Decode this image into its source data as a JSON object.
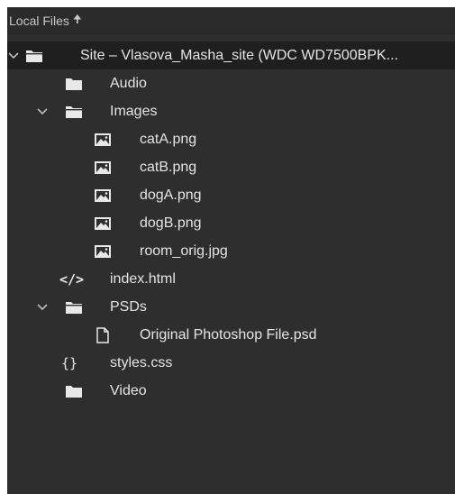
{
  "header": {
    "title": "Local Files",
    "sort_icon": "arrow-up-icon"
  },
  "tree": {
    "site": {
      "label": "Site – Vlasova_Masha_site (WDC WD7500BPK...",
      "expanded": true
    },
    "audio": {
      "label": "Audio"
    },
    "images": {
      "label": "Images",
      "expanded": true
    },
    "catA": {
      "label": "catA.png"
    },
    "catB": {
      "label": "catB.png"
    },
    "dogA": {
      "label": "dogA.png"
    },
    "dogB": {
      "label": "dogB.png"
    },
    "room": {
      "label": "room_orig.jpg"
    },
    "index": {
      "label": "index.html"
    },
    "psds": {
      "label": "PSDs",
      "expanded": true
    },
    "psdfile": {
      "label": "Original Photoshop File.psd"
    },
    "styles": {
      "label": "styles.css"
    },
    "video": {
      "label": "Video"
    }
  },
  "icons": {
    "folder": "folder-icon",
    "image": "image-file-icon",
    "code": "code-file-icon",
    "document": "document-icon",
    "css": "css-file-icon",
    "chevron": "chevron-down-icon"
  },
  "colors": {
    "panel_background": "#2e2e2e",
    "selected_row": "#1f1f1f",
    "text": "#e4e4e4",
    "icon": "#e8e8e8"
  }
}
